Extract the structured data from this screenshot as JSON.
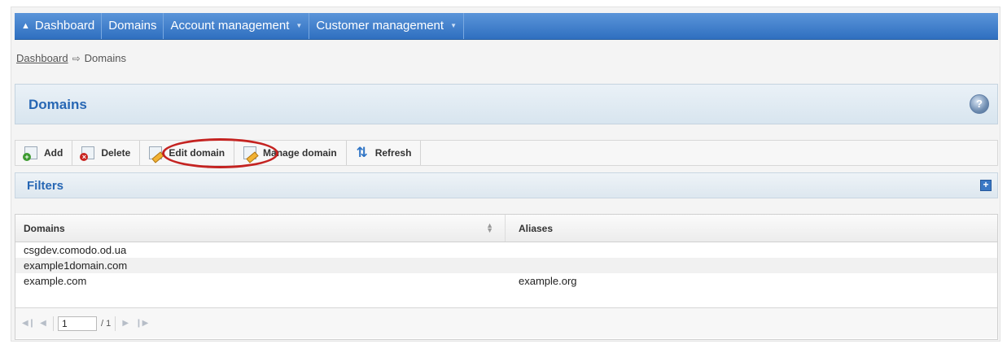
{
  "nav": {
    "items": [
      {
        "label": "Dashboard",
        "icon": "home-icon",
        "has_caret": false
      },
      {
        "label": "Domains",
        "has_caret": false
      },
      {
        "label": "Account management",
        "has_caret": true
      },
      {
        "label": "Customer management",
        "has_caret": true
      }
    ]
  },
  "breadcrumb": {
    "link": "Dashboard",
    "separator_icon": "arrow-right-icon",
    "current": "Domains"
  },
  "page": {
    "title": "Domains",
    "help_icon": "help-icon"
  },
  "toolbar": {
    "add_label": "Add",
    "delete_label": "Delete",
    "edit_label": "Edit domain",
    "manage_label": "Manage domain",
    "refresh_label": "Refresh"
  },
  "filters": {
    "title": "Filters"
  },
  "grid": {
    "columns": [
      "Domains",
      "Aliases"
    ],
    "rows": [
      {
        "domain": "csgdev.comodo.od.ua",
        "alias": ""
      },
      {
        "domain": "example1domain.com",
        "alias": ""
      },
      {
        "domain": "example.com",
        "alias": "example.org"
      }
    ]
  },
  "pager": {
    "page_value": "1",
    "total_label": "/ 1"
  },
  "colors": {
    "nav_bg": "#3a7bc8",
    "title_text": "#2767b4",
    "highlight_ring": "#c42321"
  }
}
